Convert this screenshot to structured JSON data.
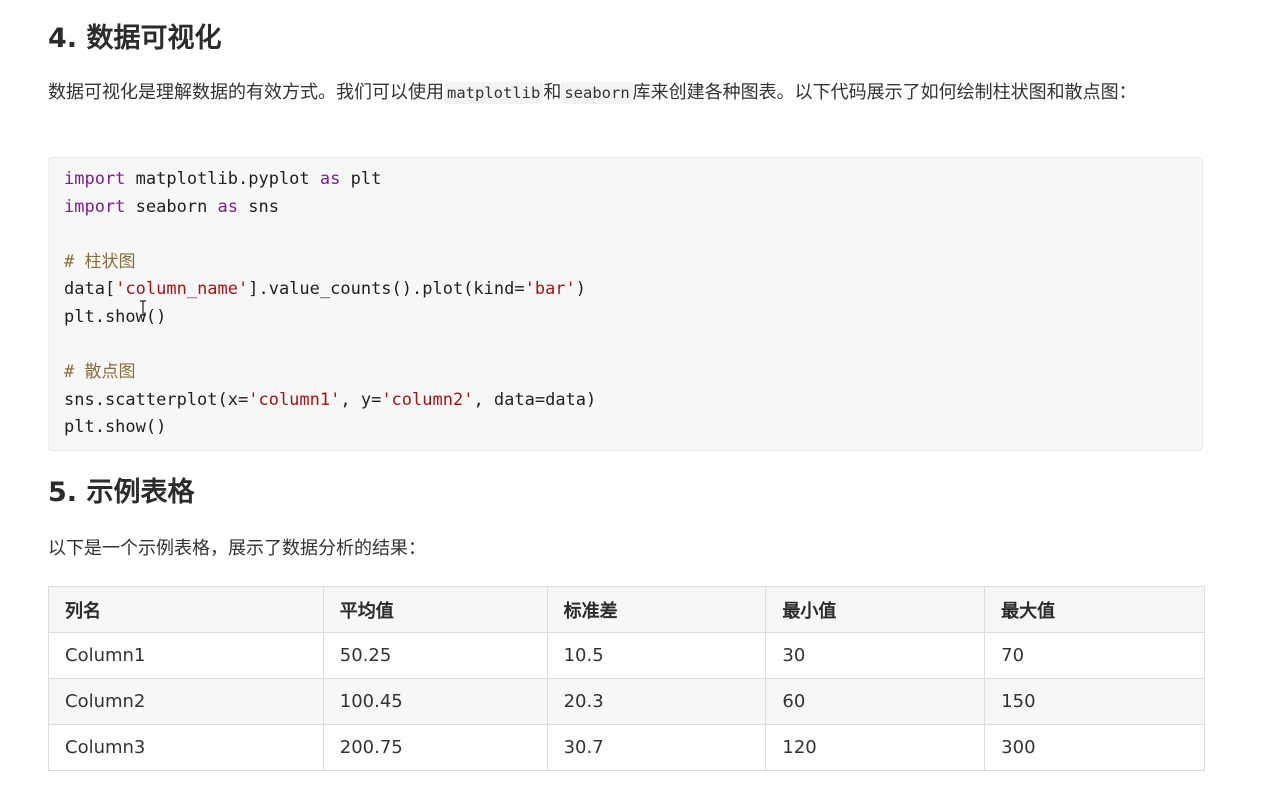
{
  "section_vis": {
    "heading": "4. 数据可视化",
    "para_before1": "数据可视化是理解数据的有效方式。我们可以使用",
    "code1": "matplotlib",
    "para_between": "和",
    "code2": "seaborn",
    "para_after": "库来创建各种图表。以下代码展示了如何绘制柱状图和散点图："
  },
  "code_block": {
    "line1": {
      "kw1": "import",
      "mod": " matplotlib.pyplot ",
      "kw2": "as",
      "alias": " plt"
    },
    "line2": {
      "kw1": "import",
      "mod": " seaborn ",
      "kw2": "as",
      "alias": " sns"
    },
    "comment1": "# 柱状图",
    "line4": {
      "a": "data[",
      "s1": "'column_name'",
      "b": "].value_counts().plot(kind=",
      "s2": "'bar'",
      "c": ")"
    },
    "line5": "plt.show()",
    "comment2": "# 散点图",
    "line7": {
      "a": "sns.scatterplot(x=",
      "s1": "'column1'",
      "b": ", y=",
      "s2": "'column2'",
      "c": ", data=data)"
    },
    "line8": "plt.show()"
  },
  "section_table": {
    "heading": "5. 示例表格",
    "intro": "以下是一个示例表格，展示了数据分析的结果：",
    "headers": [
      "列名",
      "平均值",
      "标准差",
      "最小值",
      "最大值"
    ],
    "rows": [
      [
        "Column1",
        "50.25",
        "10.5",
        "30",
        "70"
      ],
      [
        "Column2",
        "100.45",
        "20.3",
        "60",
        "150"
      ],
      [
        "Column3",
        "200.75",
        "30.7",
        "120",
        "300"
      ]
    ]
  }
}
